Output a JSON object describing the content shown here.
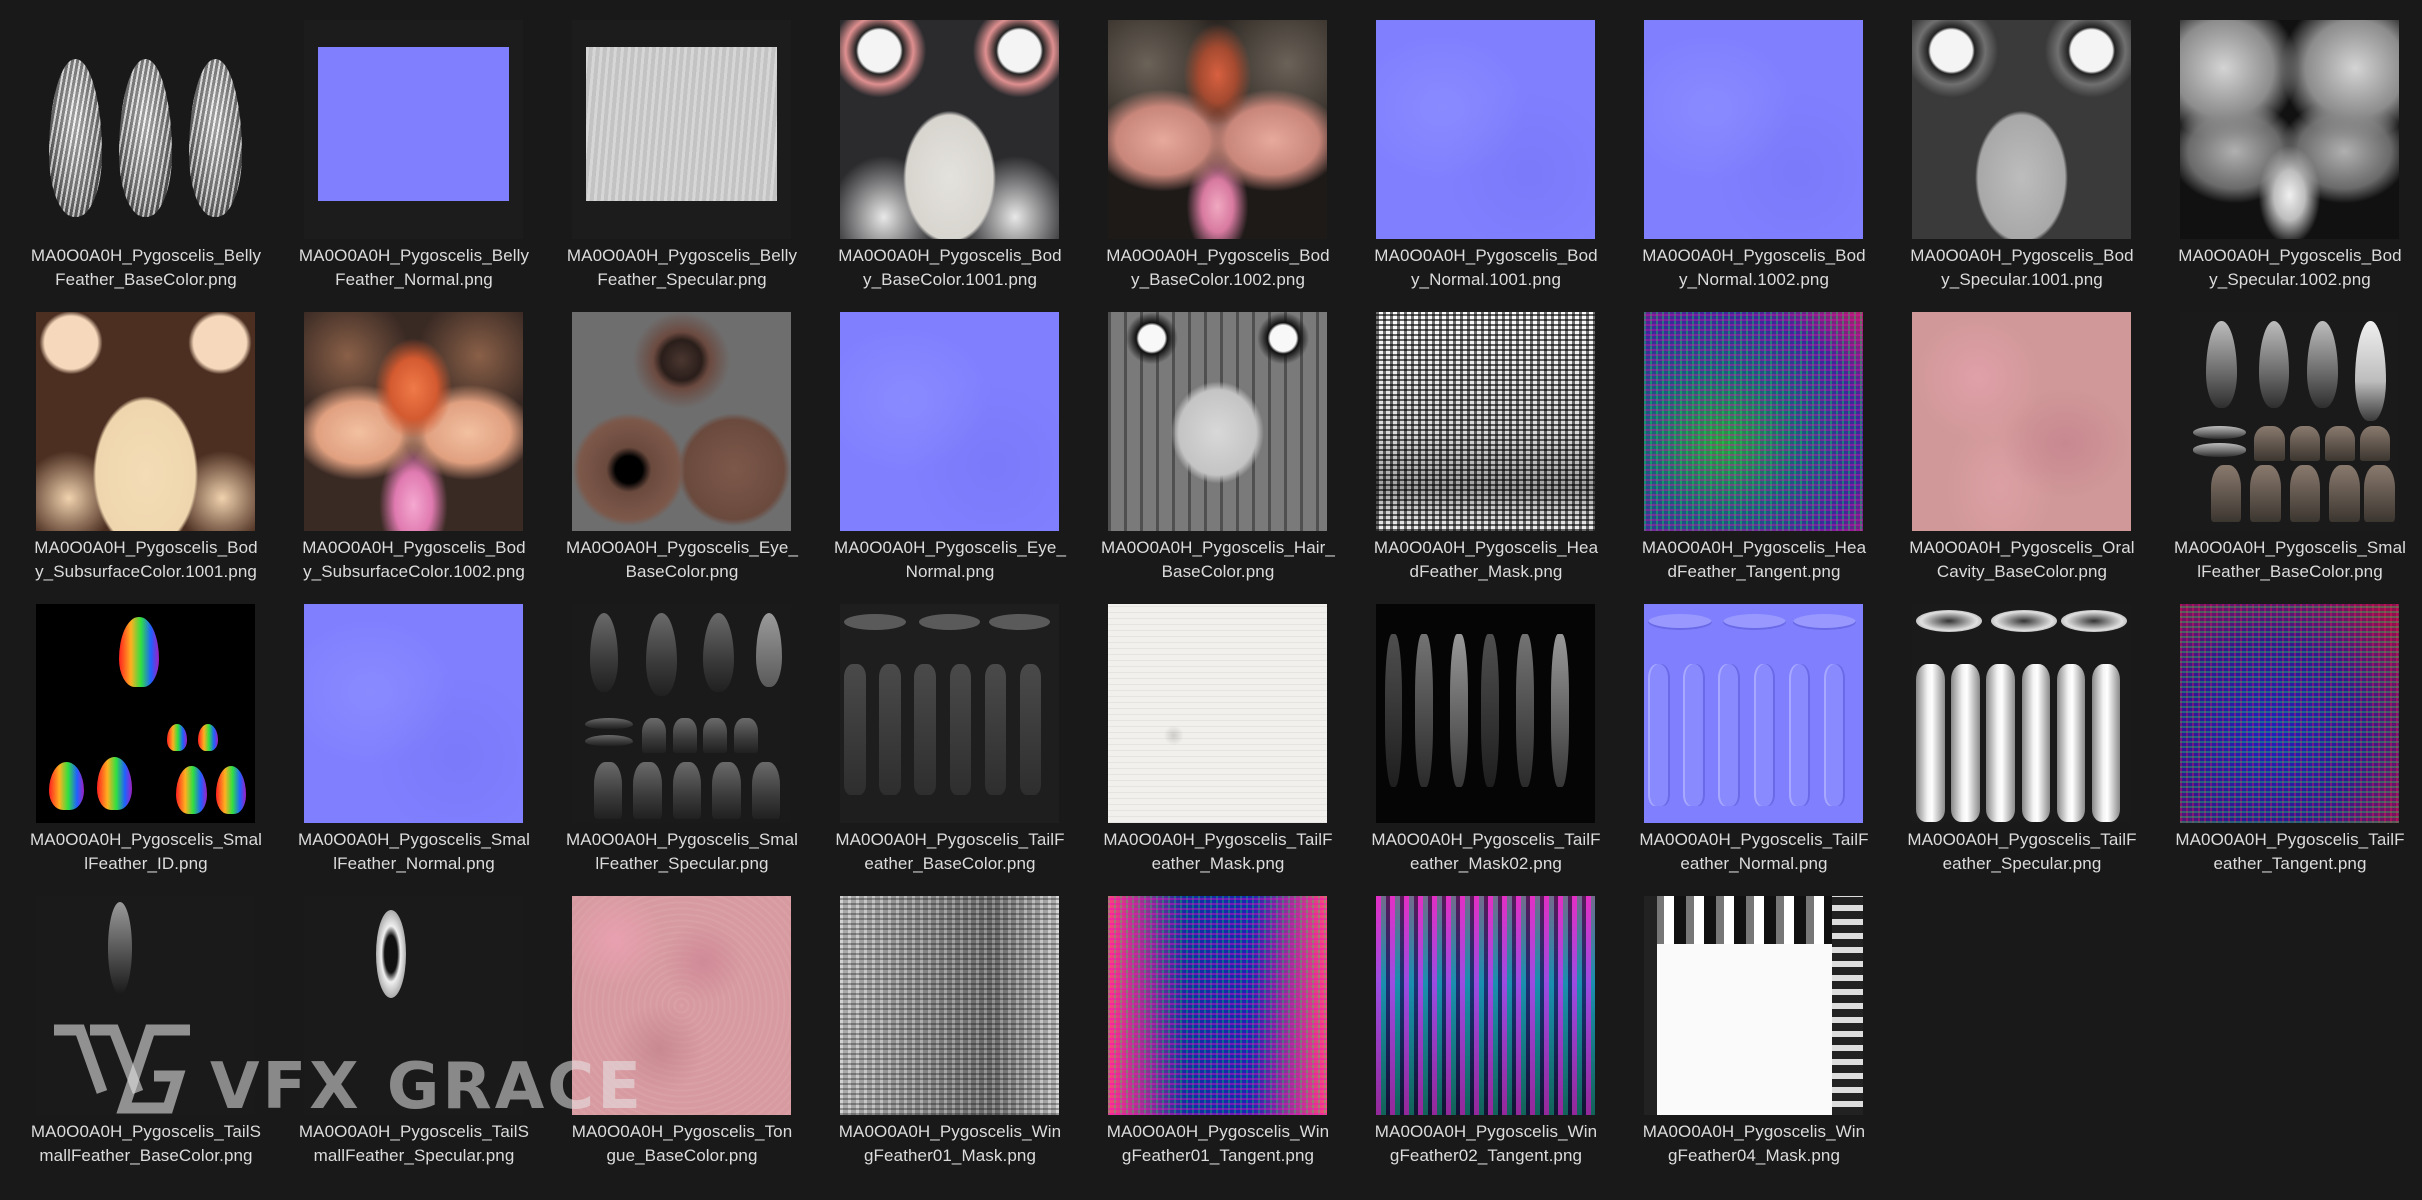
{
  "files": [
    {
      "name": "MA0O0A0H_Pygoscelis_BellyFeather_BaseColor.png",
      "line1": "MA0O0A0H_Pygoscelis_Belly",
      "line2": "Feather_BaseColor.png",
      "icon": "belly-feather-basecolor-thumbnail"
    },
    {
      "name": "MA0O0A0H_Pygoscelis_BellyFeather_Normal.png",
      "line1": "MA0O0A0H_Pygoscelis_Belly",
      "line2": "Feather_Normal.png",
      "icon": "belly-feather-normal-thumbnail"
    },
    {
      "name": "MA0O0A0H_Pygoscelis_BellyFeather_Specular.png",
      "line1": "MA0O0A0H_Pygoscelis_Belly",
      "line2": "Feather_Specular.png",
      "icon": "belly-feather-specular-thumbnail"
    },
    {
      "name": "MA0O0A0H_Pygoscelis_Body_BaseColor.1001.png",
      "line1": "MA0O0A0H_Pygoscelis_Bod",
      "line2": "y_BaseColor.1001.png",
      "icon": "body-basecolor-1001-thumbnail"
    },
    {
      "name": "MA0O0A0H_Pygoscelis_Body_BaseColor.1002.png",
      "line1": "MA0O0A0H_Pygoscelis_Bod",
      "line2": "y_BaseColor.1002.png",
      "icon": "body-basecolor-1002-thumbnail"
    },
    {
      "name": "MA0O0A0H_Pygoscelis_Body_Normal.1001.png",
      "line1": "MA0O0A0H_Pygoscelis_Bod",
      "line2": "y_Normal.1001.png",
      "icon": "body-normal-1001-thumbnail"
    },
    {
      "name": "MA0O0A0H_Pygoscelis_Body_Normal.1002.png",
      "line1": "MA0O0A0H_Pygoscelis_Bod",
      "line2": "y_Normal.1002.png",
      "icon": "body-normal-1002-thumbnail"
    },
    {
      "name": "MA0O0A0H_Pygoscelis_Body_Specular.1001.png",
      "line1": "MA0O0A0H_Pygoscelis_Bod",
      "line2": "y_Specular.1001.png",
      "icon": "body-specular-1001-thumbnail"
    },
    {
      "name": "MA0O0A0H_Pygoscelis_Body_Specular.1002.png",
      "line1": "MA0O0A0H_Pygoscelis_Bod",
      "line2": "y_Specular.1002.png",
      "icon": "body-specular-1002-thumbnail"
    },
    {
      "name": "MA0O0A0H_Pygoscelis_Body_SubsurfaceColor.1001.png",
      "line1": "MA0O0A0H_Pygoscelis_Bod",
      "line2": "y_SubsurfaceColor.1001.png",
      "icon": "body-subsurface-1001-thumbnail"
    },
    {
      "name": "MA0O0A0H_Pygoscelis_Body_SubsurfaceColor.1002.png",
      "line1": "MA0O0A0H_Pygoscelis_Bod",
      "line2": "y_SubsurfaceColor.1002.png",
      "icon": "body-subsurface-1002-thumbnail"
    },
    {
      "name": "MA0O0A0H_Pygoscelis_Eye_BaseColor.png",
      "line1": "MA0O0A0H_Pygoscelis_Eye_",
      "line2": "BaseColor.png",
      "icon": "eye-basecolor-thumbnail"
    },
    {
      "name": "MA0O0A0H_Pygoscelis_Eye_Normal.png",
      "line1": "MA0O0A0H_Pygoscelis_Eye_",
      "line2": "Normal.png",
      "icon": "eye-normal-thumbnail"
    },
    {
      "name": "MA0O0A0H_Pygoscelis_Hair_BaseColor.png",
      "line1": "MA0O0A0H_Pygoscelis_Hair_",
      "line2": "BaseColor.png",
      "icon": "hair-basecolor-thumbnail"
    },
    {
      "name": "MA0O0A0H_Pygoscelis_HeadFeather_Mask.png",
      "line1": "MA0O0A0H_Pygoscelis_Hea",
      "line2": "dFeather_Mask.png",
      "icon": "head-feather-mask-thumbnail"
    },
    {
      "name": "MA0O0A0H_Pygoscelis_HeadFeather_Tangent.png",
      "line1": "MA0O0A0H_Pygoscelis_Hea",
      "line2": "dFeather_Tangent.png",
      "icon": "head-feather-tangent-thumbnail"
    },
    {
      "name": "MA0O0A0H_Pygoscelis_OralCavity_BaseColor.png",
      "line1": "MA0O0A0H_Pygoscelis_Oral",
      "line2": "Cavity_BaseColor.png",
      "icon": "oral-cavity-basecolor-thumbnail"
    },
    {
      "name": "MA0O0A0H_Pygoscelis_SmallFeather_BaseColor.png",
      "line1": "MA0O0A0H_Pygoscelis_Smal",
      "line2": "lFeather_BaseColor.png",
      "icon": "small-feather-basecolor-thumbnail"
    },
    {
      "name": "MA0O0A0H_Pygoscelis_SmallFeather_ID.png",
      "line1": "MA0O0A0H_Pygoscelis_Smal",
      "line2": "lFeather_ID.png",
      "icon": "small-feather-id-thumbnail"
    },
    {
      "name": "MA0O0A0H_Pygoscelis_SmallFeather_Normal.png",
      "line1": "MA0O0A0H_Pygoscelis_Smal",
      "line2": "lFeather_Normal.png",
      "icon": "small-feather-normal-thumbnail"
    },
    {
      "name": "MA0O0A0H_Pygoscelis_SmallFeather_Specular.png",
      "line1": "MA0O0A0H_Pygoscelis_Smal",
      "line2": "lFeather_Specular.png",
      "icon": "small-feather-specular-thumbnail"
    },
    {
      "name": "MA0O0A0H_Pygoscelis_TailFeather_BaseColor.png",
      "line1": "MA0O0A0H_Pygoscelis_TailF",
      "line2": "eather_BaseColor.png",
      "icon": "tail-feather-basecolor-thumbnail"
    },
    {
      "name": "MA0O0A0H_Pygoscelis_TailFeather_Mask.png",
      "line1": "MA0O0A0H_Pygoscelis_TailF",
      "line2": "eather_Mask.png",
      "icon": "tail-feather-mask-thumbnail"
    },
    {
      "name": "MA0O0A0H_Pygoscelis_TailFeather_Mask02.png",
      "line1": "MA0O0A0H_Pygoscelis_TailF",
      "line2": "eather_Mask02.png",
      "icon": "tail-feather-mask02-thumbnail"
    },
    {
      "name": "MA0O0A0H_Pygoscelis_TailFeather_Normal.png",
      "line1": "MA0O0A0H_Pygoscelis_TailF",
      "line2": "eather_Normal.png",
      "icon": "tail-feather-normal-thumbnail"
    },
    {
      "name": "MA0O0A0H_Pygoscelis_TailFeather_Specular.png",
      "line1": "MA0O0A0H_Pygoscelis_TailF",
      "line2": "eather_Specular.png",
      "icon": "tail-feather-specular-thumbnail"
    },
    {
      "name": "MA0O0A0H_Pygoscelis_TailFeather_Tangent.png",
      "line1": "MA0O0A0H_Pygoscelis_TailF",
      "line2": "eather_Tangent.png",
      "icon": "tail-feather-tangent-thumbnail"
    },
    {
      "name": "MA0O0A0H_Pygoscelis_TailSmallFeather_BaseColor.png",
      "line1": "MA0O0A0H_Pygoscelis_TailS",
      "line2": "mallFeather_BaseColor.png",
      "icon": "tail-small-feather-basecolor-thumbnail"
    },
    {
      "name": "MA0O0A0H_Pygoscelis_TailSmallFeather_Specular.png",
      "line1": "MA0O0A0H_Pygoscelis_TailS",
      "line2": "mallFeather_Specular.png",
      "icon": "tail-small-feather-specular-thumbnail"
    },
    {
      "name": "MA0O0A0H_Pygoscelis_Tongue_BaseColor.png",
      "line1": "MA0O0A0H_Pygoscelis_Ton",
      "line2": "gue_BaseColor.png",
      "icon": "tongue-basecolor-thumbnail"
    },
    {
      "name": "MA0O0A0H_Pygoscelis_WingFeather01_Mask.png",
      "line1": "MA0O0A0H_Pygoscelis_Win",
      "line2": "gFeather01_Mask.png",
      "icon": "wing-feather01-mask-thumbnail"
    },
    {
      "name": "MA0O0A0H_Pygoscelis_WingFeather01_Tangent.png",
      "line1": "MA0O0A0H_Pygoscelis_Win",
      "line2": "gFeather01_Tangent.png",
      "icon": "wing-feather01-tangent-thumbnail"
    },
    {
      "name": "MA0O0A0H_Pygoscelis_WingFeather02_Tangent.png",
      "line1": "MA0O0A0H_Pygoscelis_Win",
      "line2": "gFeather02_Tangent.png",
      "icon": "wing-feather02-tangent-thumbnail"
    },
    {
      "name": "MA0O0A0H_Pygoscelis_WingFeather04_Mask.png",
      "line1": "MA0O0A0H_Pygoscelis_Win",
      "line2": "gFeather04_Mask.png",
      "icon": "wing-feather04-mask-thumbnail"
    }
  ],
  "watermark": {
    "text": "VFX GRACE",
    "icon": "vfx-grace-logo-icon"
  },
  "colors": {
    "background": "#191919",
    "label": "#dcdcdc",
    "normal_map": "#8080ff"
  }
}
